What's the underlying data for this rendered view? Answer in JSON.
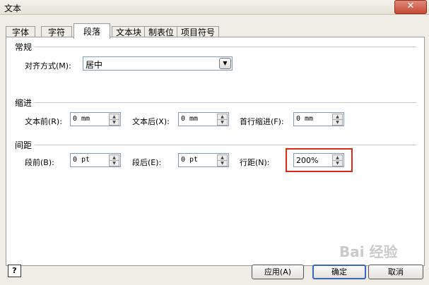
{
  "window": {
    "title": "文本",
    "close_glyph": "✕"
  },
  "tabs": [
    {
      "label": "字体"
    },
    {
      "label": "字符"
    },
    {
      "label": "段落"
    },
    {
      "label": "文本块"
    },
    {
      "label": "制表位"
    },
    {
      "label": "项目符号"
    }
  ],
  "active_tab": "段落",
  "general": {
    "title": "常规",
    "align_label": "对齐方式(M):",
    "align_value": "居中"
  },
  "indent": {
    "title": "缩进",
    "before_label": "文本前(R):",
    "before_value": "0 mm",
    "after_label": "文本后(X):",
    "after_value": "0 mm",
    "first_label": "首行缩进(F):",
    "first_value": "0 mm"
  },
  "spacing": {
    "title": "间距",
    "before_label": "段前(B):",
    "before_value": "0 pt",
    "after_label": "段后(E):",
    "after_value": "0 pt",
    "line_label": "行距(N):",
    "line_value": "200%"
  },
  "footer": {
    "help_glyph": "?",
    "apply_label": "应用(A)",
    "ok_label": "确定",
    "cancel_label": "取消"
  },
  "watermark": "Bai 经验"
}
